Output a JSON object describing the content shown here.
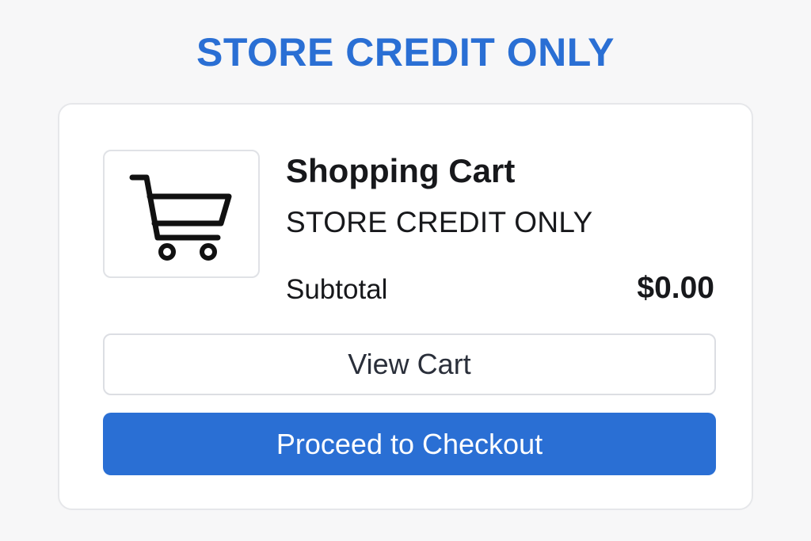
{
  "banner": {
    "text": "STORE CREDIT ONLY"
  },
  "cart": {
    "title": "Shopping Cart",
    "subtitle": "STORE CREDIT ONLY",
    "subtotal_label": "Subtotal",
    "subtotal_value": "$0.00",
    "icon": "shopping-cart-icon"
  },
  "buttons": {
    "view_cart": "View Cart",
    "checkout": "Proceed to Checkout"
  },
  "colors": {
    "accent": "#2a6fd4",
    "text": "#17181b",
    "background": "#f7f7f8",
    "card": "#ffffff"
  }
}
